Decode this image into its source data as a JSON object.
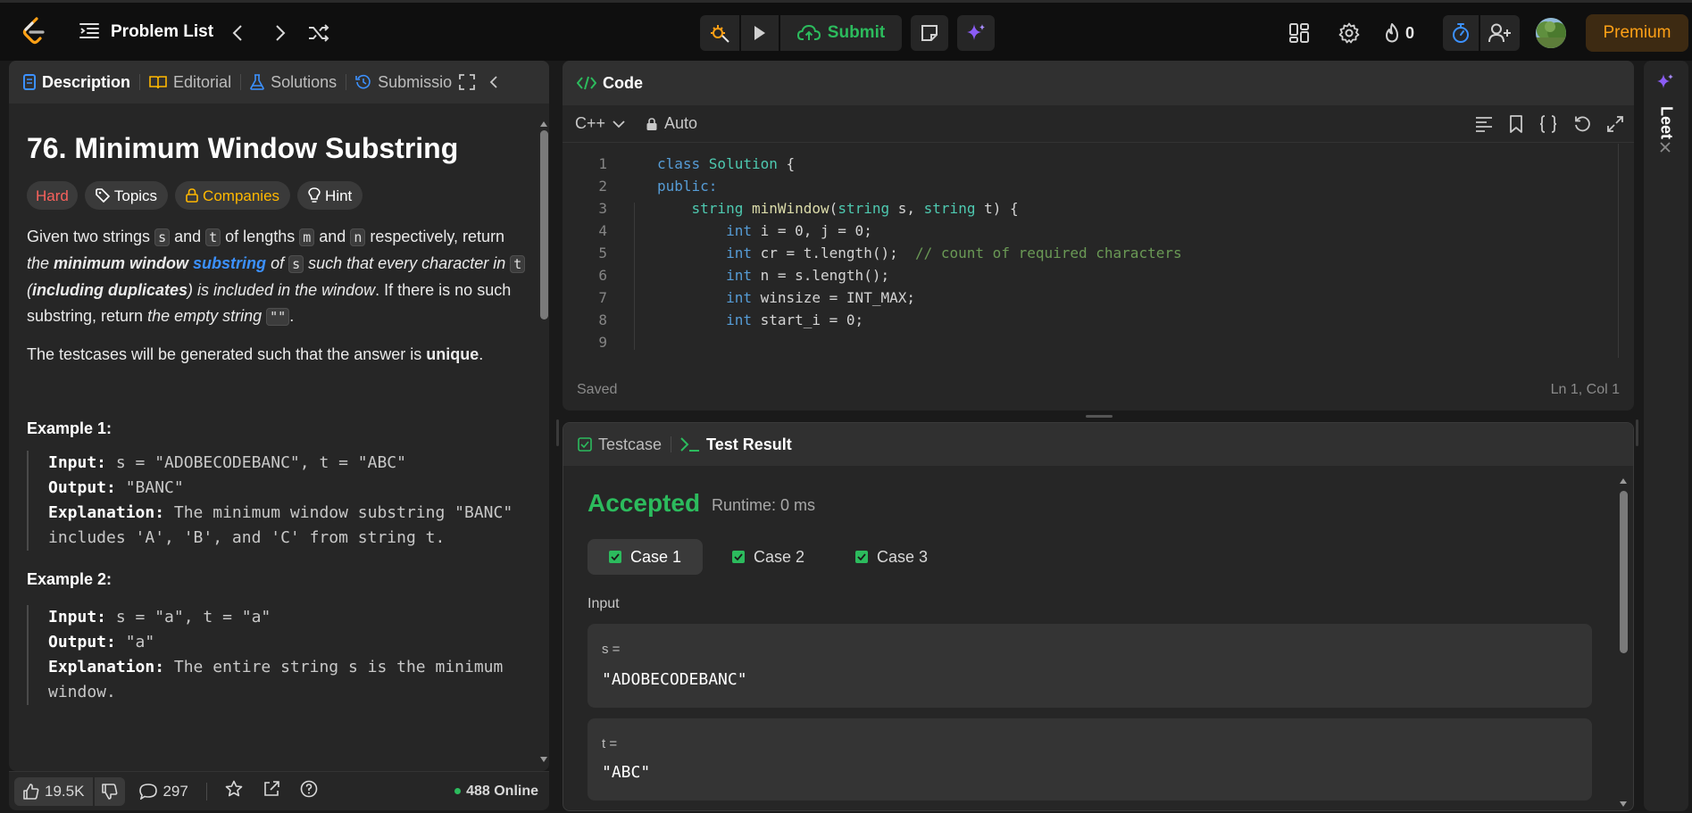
{
  "topbar": {
    "problem_list": "Problem List",
    "submit": "Submit",
    "streak_count": "0",
    "premium": "Premium"
  },
  "left_tabs": [
    "Description",
    "Editorial",
    "Solutions",
    "Submissio"
  ],
  "problem": {
    "title": "76. Minimum Window Substring",
    "difficulty": "Hard",
    "tags": [
      "Topics",
      "Companies",
      "Hint"
    ],
    "p1_a": "Given two strings ",
    "code_s": "s",
    "p1_b": " and ",
    "code_t": "t",
    "p1_c": " of lengths ",
    "code_m": "m",
    "p1_d": " and ",
    "code_n": "n",
    "p1_e": " respectively, return ",
    "p1_f": "the ",
    "p1_g": "minimum window",
    "p1_h": "substring",
    "p1_i": " of ",
    "p1_j": " such that every character in ",
    "p1_k": " (",
    "p1_l": "including duplicates",
    "p1_m": ") is included in the window",
    "p1_n": ". If there is no such substring, return ",
    "p1_o": "the empty string",
    "code_empty": "\"\"",
    "p1_p": ".",
    "p2_a": "The testcases will be generated such that the answer is ",
    "p2_b": "unique",
    "p2_c": ".",
    "ex1_h": "Example 1:",
    "ex_input": "Input:",
    "ex_output": "Output:",
    "ex_expl": "Explanation:",
    "ex1_input": " s = \"ADOBECODEBANC\", t = \"ABC\"",
    "ex1_output": " \"BANC\"",
    "ex1_expl": " The minimum window substring \"BANC\" includes 'A', 'B', and 'C' from string t.",
    "ex2_h": "Example 2:",
    "ex2_input": " s = \"a\", t = \"a\"",
    "ex2_output": " \"a\"",
    "ex2_expl": " The entire string s is the minimum window."
  },
  "footer": {
    "likes": "19.5K",
    "comments": "297",
    "online": "488 Online"
  },
  "code_panel": {
    "title": "Code",
    "language": "C++",
    "mode": "Auto",
    "saved": "Saved",
    "cursor": "Ln 1, Col 1",
    "side_label": "Leet",
    "lines": [
      [
        [
          "kw",
          "class "
        ],
        [
          "ty",
          "Solution"
        ],
        [
          "tx",
          " {"
        ]
      ],
      [
        [
          "kw",
          "public:"
        ]
      ],
      [
        [
          "tx",
          "    "
        ],
        [
          "ty",
          "string "
        ],
        [
          "fn",
          "minWindow"
        ],
        [
          "tx",
          "("
        ],
        [
          "ty",
          "string "
        ],
        [
          "tx",
          "s, "
        ],
        [
          "ty",
          "string "
        ],
        [
          "tx",
          "t) {"
        ]
      ],
      [
        [
          "tx",
          "        "
        ],
        [
          "kw",
          "int "
        ],
        [
          "tx",
          "i = 0, j = 0;"
        ]
      ],
      [
        [
          "tx",
          "        "
        ],
        [
          "kw",
          "int "
        ],
        [
          "tx",
          "cr = t.length();  "
        ],
        [
          "cm",
          "// count of required characters"
        ]
      ],
      [
        [
          "tx",
          "        "
        ],
        [
          "kw",
          "int "
        ],
        [
          "tx",
          "n = s.length();"
        ]
      ],
      [
        [
          "tx",
          "        "
        ],
        [
          "kw",
          "int "
        ],
        [
          "tx",
          "winsize = INT_MAX;"
        ]
      ],
      [
        [
          "tx",
          "        "
        ],
        [
          "kw",
          "int "
        ],
        [
          "tx",
          "start_i = 0;"
        ]
      ],
      [
        [
          "tx",
          ""
        ]
      ]
    ]
  },
  "result_panel": {
    "tab_testcase": "Testcase",
    "tab_result": "Test Result",
    "status": "Accepted",
    "runtime": "Runtime: 0 ms",
    "cases": [
      "Case 1",
      "Case 2",
      "Case 3"
    ],
    "input_label": "Input",
    "var_s_label": "s =",
    "var_s_value": "\"ADOBECODEBANC\"",
    "var_t_label": "t =",
    "var_t_value": "\"ABC\""
  },
  "colors": {
    "accent_green": "#2cbb5d",
    "hard_red": "#f8615c",
    "companies_orange": "#ffb800",
    "link_blue": "#3c91ff",
    "premium_orange": "#ffa116"
  }
}
